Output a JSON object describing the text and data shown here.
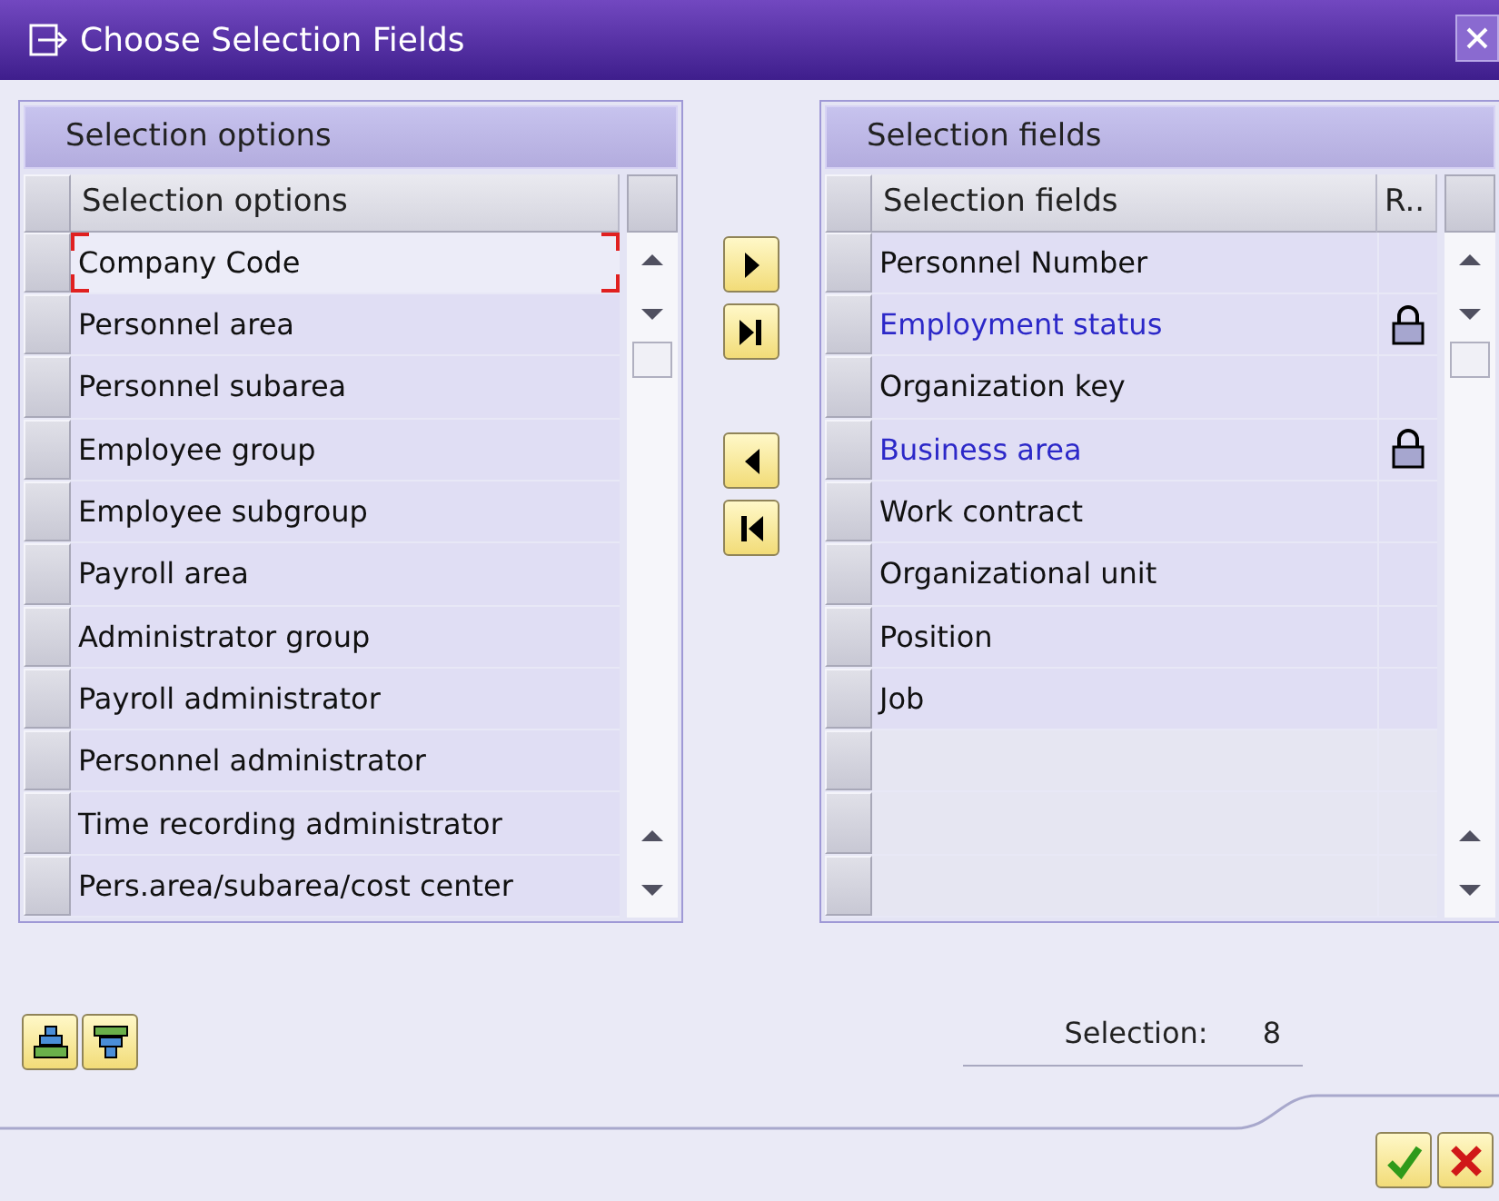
{
  "window": {
    "title": "Choose Selection Fields"
  },
  "left_panel": {
    "title": "Selection options",
    "column_header": "Selection options",
    "rows": [
      {
        "label": "Company Code",
        "focused": true
      },
      {
        "label": "Personnel area",
        "focused": false
      },
      {
        "label": "Personnel subarea",
        "focused": false
      },
      {
        "label": "Employee group",
        "focused": false
      },
      {
        "label": "Employee subgroup",
        "focused": false
      },
      {
        "label": "Payroll area",
        "focused": false
      },
      {
        "label": "Administrator group",
        "focused": false
      },
      {
        "label": "Payroll administrator",
        "focused": false
      },
      {
        "label": "Personnel administrator",
        "focused": false
      },
      {
        "label": "Time recording administrator",
        "focused": false
      },
      {
        "label": "Pers.area/subarea/cost center",
        "focused": false
      }
    ]
  },
  "right_panel": {
    "title": "Selection fields",
    "columns": [
      "Selection fields",
      "R.."
    ],
    "rows": [
      {
        "label": "Personnel Number",
        "locked": false
      },
      {
        "label": "Employment status",
        "locked": true
      },
      {
        "label": "Organization key",
        "locked": false
      },
      {
        "label": "Business area",
        "locked": true
      },
      {
        "label": "Work contract",
        "locked": false
      },
      {
        "label": "Organizational unit",
        "locked": false
      },
      {
        "label": "Position",
        "locked": false
      },
      {
        "label": "Job",
        "locked": false
      }
    ]
  },
  "move_buttons": [
    {
      "kind": "add"
    },
    {
      "kind": "add_all"
    },
    {
      "kind": "remove"
    },
    {
      "kind": "remove_all"
    }
  ],
  "tool_buttons": [
    {
      "kind": "raise"
    },
    {
      "kind": "lower"
    }
  ],
  "selection": {
    "label": "Selection:",
    "count": "8"
  },
  "dialog_buttons": [
    {
      "kind": "confirm"
    },
    {
      "kind": "cancel"
    }
  ]
}
